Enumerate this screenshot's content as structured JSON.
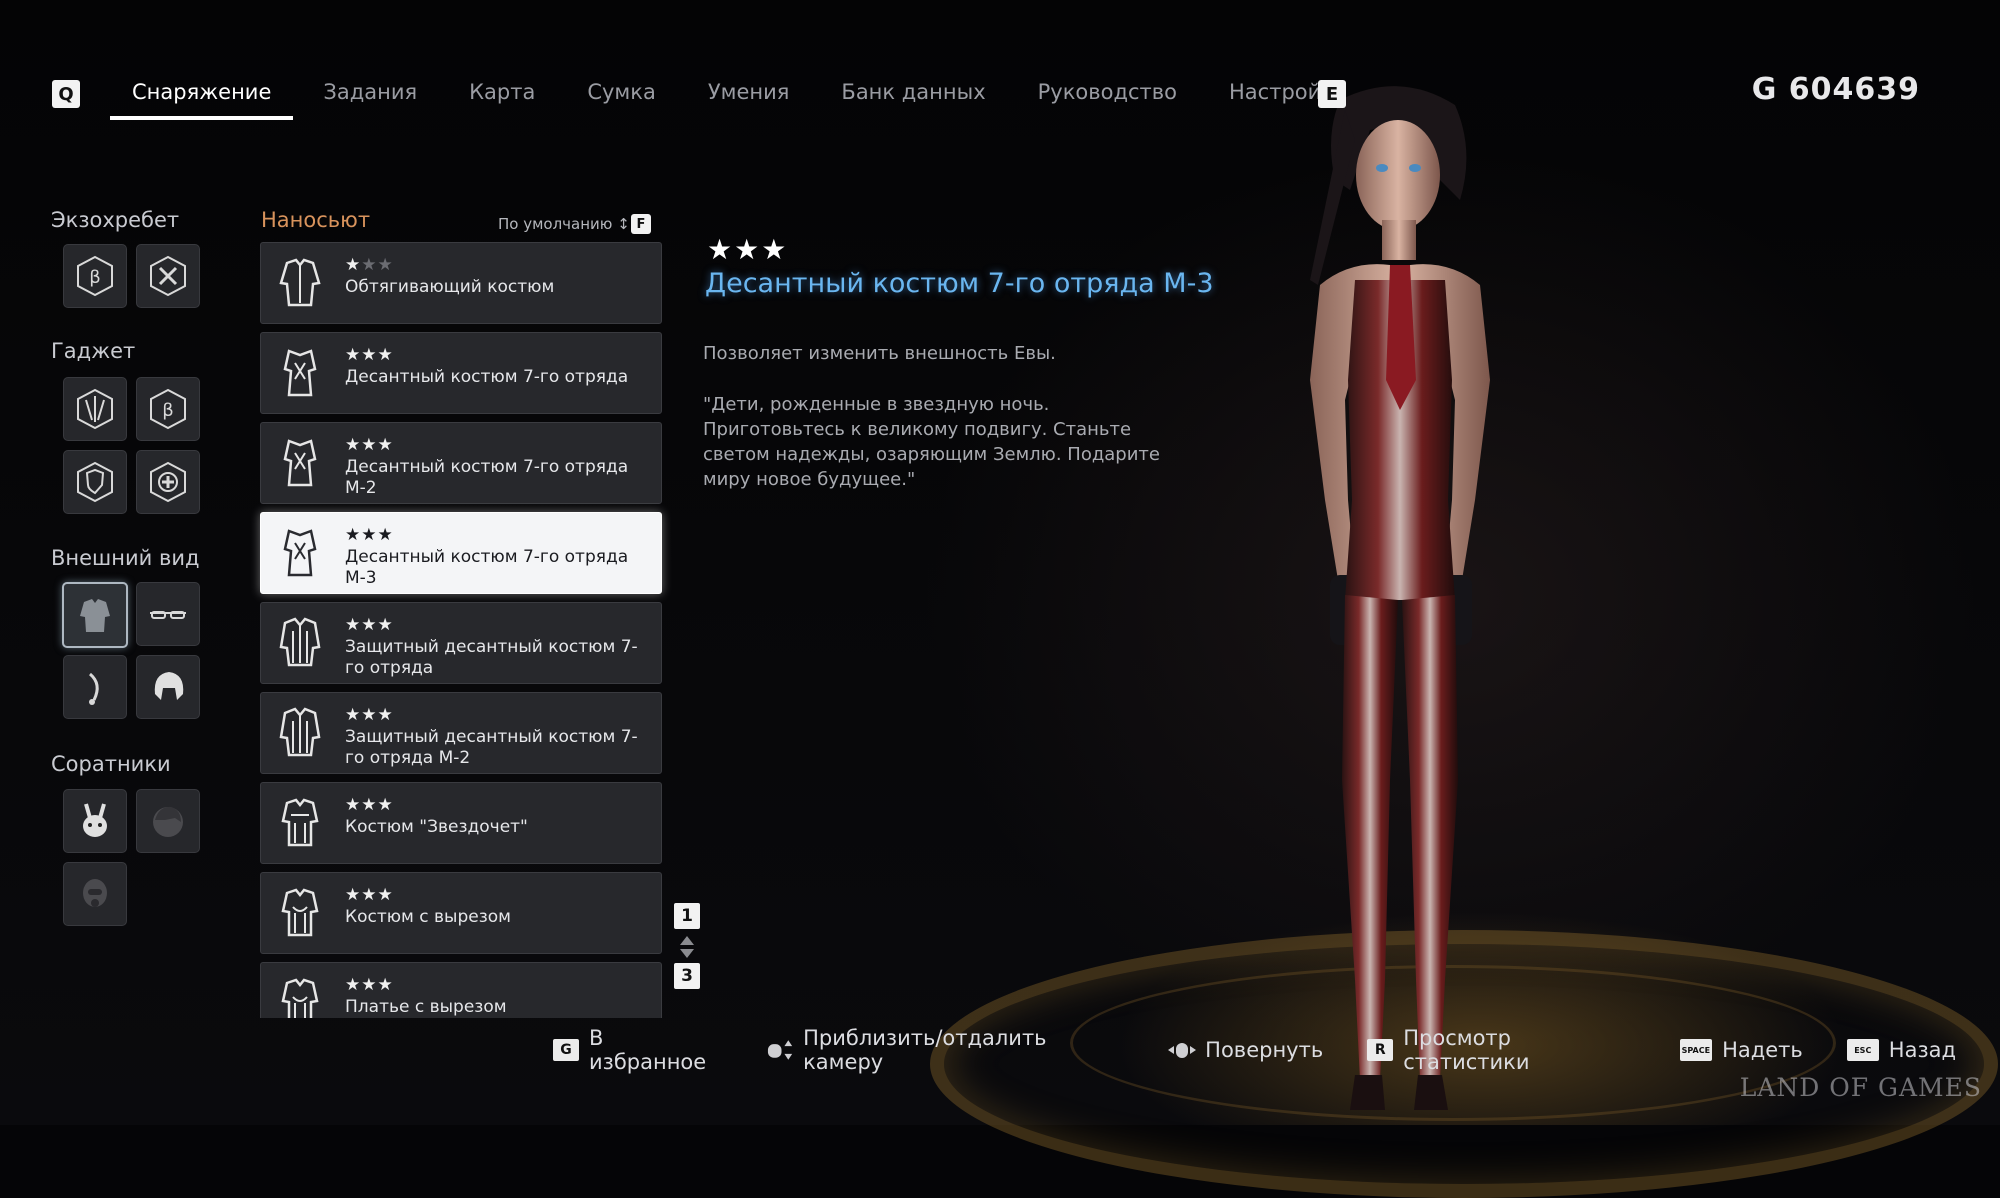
{
  "nav": {
    "left_key": "Q",
    "right_key": "E",
    "tabs": [
      {
        "label": "Снаряжение",
        "active": true
      },
      {
        "label": "Задания"
      },
      {
        "label": "Карта"
      },
      {
        "label": "Сумка"
      },
      {
        "label": "Умения"
      },
      {
        "label": "Банк данных"
      },
      {
        "label": "Руководство"
      },
      {
        "label": "Настройки"
      }
    ],
    "currency": "G  604639"
  },
  "sidebar": {
    "exospine": "Экзохребет",
    "gadget": "Гаджет",
    "appearance": "Внешний вид",
    "companions": "Соратники"
  },
  "list": {
    "header": "Наносьют",
    "sort_label": "По умолчанию",
    "sort_key": "F",
    "items": [
      {
        "stars": "★",
        "stars_dim": "★★",
        "name": "Обтягивающий костюм"
      },
      {
        "stars": "★★★",
        "name": "Десантный костюм 7-го отряда"
      },
      {
        "stars": "★★★",
        "name": "Десантный костюм 7-го отряда М-2"
      },
      {
        "stars": "★★★",
        "name": "Десантный костюм 7-го отряда М-3",
        "selected": true
      },
      {
        "stars": "★★★",
        "name": "Защитный десантный костюм 7-го отряда"
      },
      {
        "stars": "★★★",
        "name": "Защитный десантный костюм 7-го отряда М-2"
      },
      {
        "stars": "★★★",
        "name": "Костюм \"Звездочет\""
      },
      {
        "stars": "★★★",
        "name": "Костюм с вырезом"
      },
      {
        "stars": "★★★",
        "name": "Платье с вырезом"
      }
    ],
    "page_current": "1",
    "page_total": "3"
  },
  "detail": {
    "stars": "★★★",
    "title": "Десантный костюм 7-го отряда М-3",
    "description": "Позволяет изменить внешность Евы.",
    "quote": "\"Дети, рожденные в звездную ночь. Приготовьтесь к великому подвигу. Станьте светом надежды, озаряющим Землю. Подарите миру новое будущее.\""
  },
  "hints": {
    "favorite_key": "G",
    "favorite": "В избранное",
    "zoom": "Приблизить/отдалить камеру",
    "rotate": "Повернуть",
    "stats_key": "R",
    "stats": "Просмотр статистики",
    "equip_key": "SPACE",
    "equip": "Надеть",
    "back_key": "ESC",
    "back": "Назад"
  },
  "watermark": "LAND OF GAMES",
  "colors": {
    "accent_title": "#6ab6f0",
    "list_header": "#d8935c",
    "selected_item_bg": "#f4f5f7"
  }
}
